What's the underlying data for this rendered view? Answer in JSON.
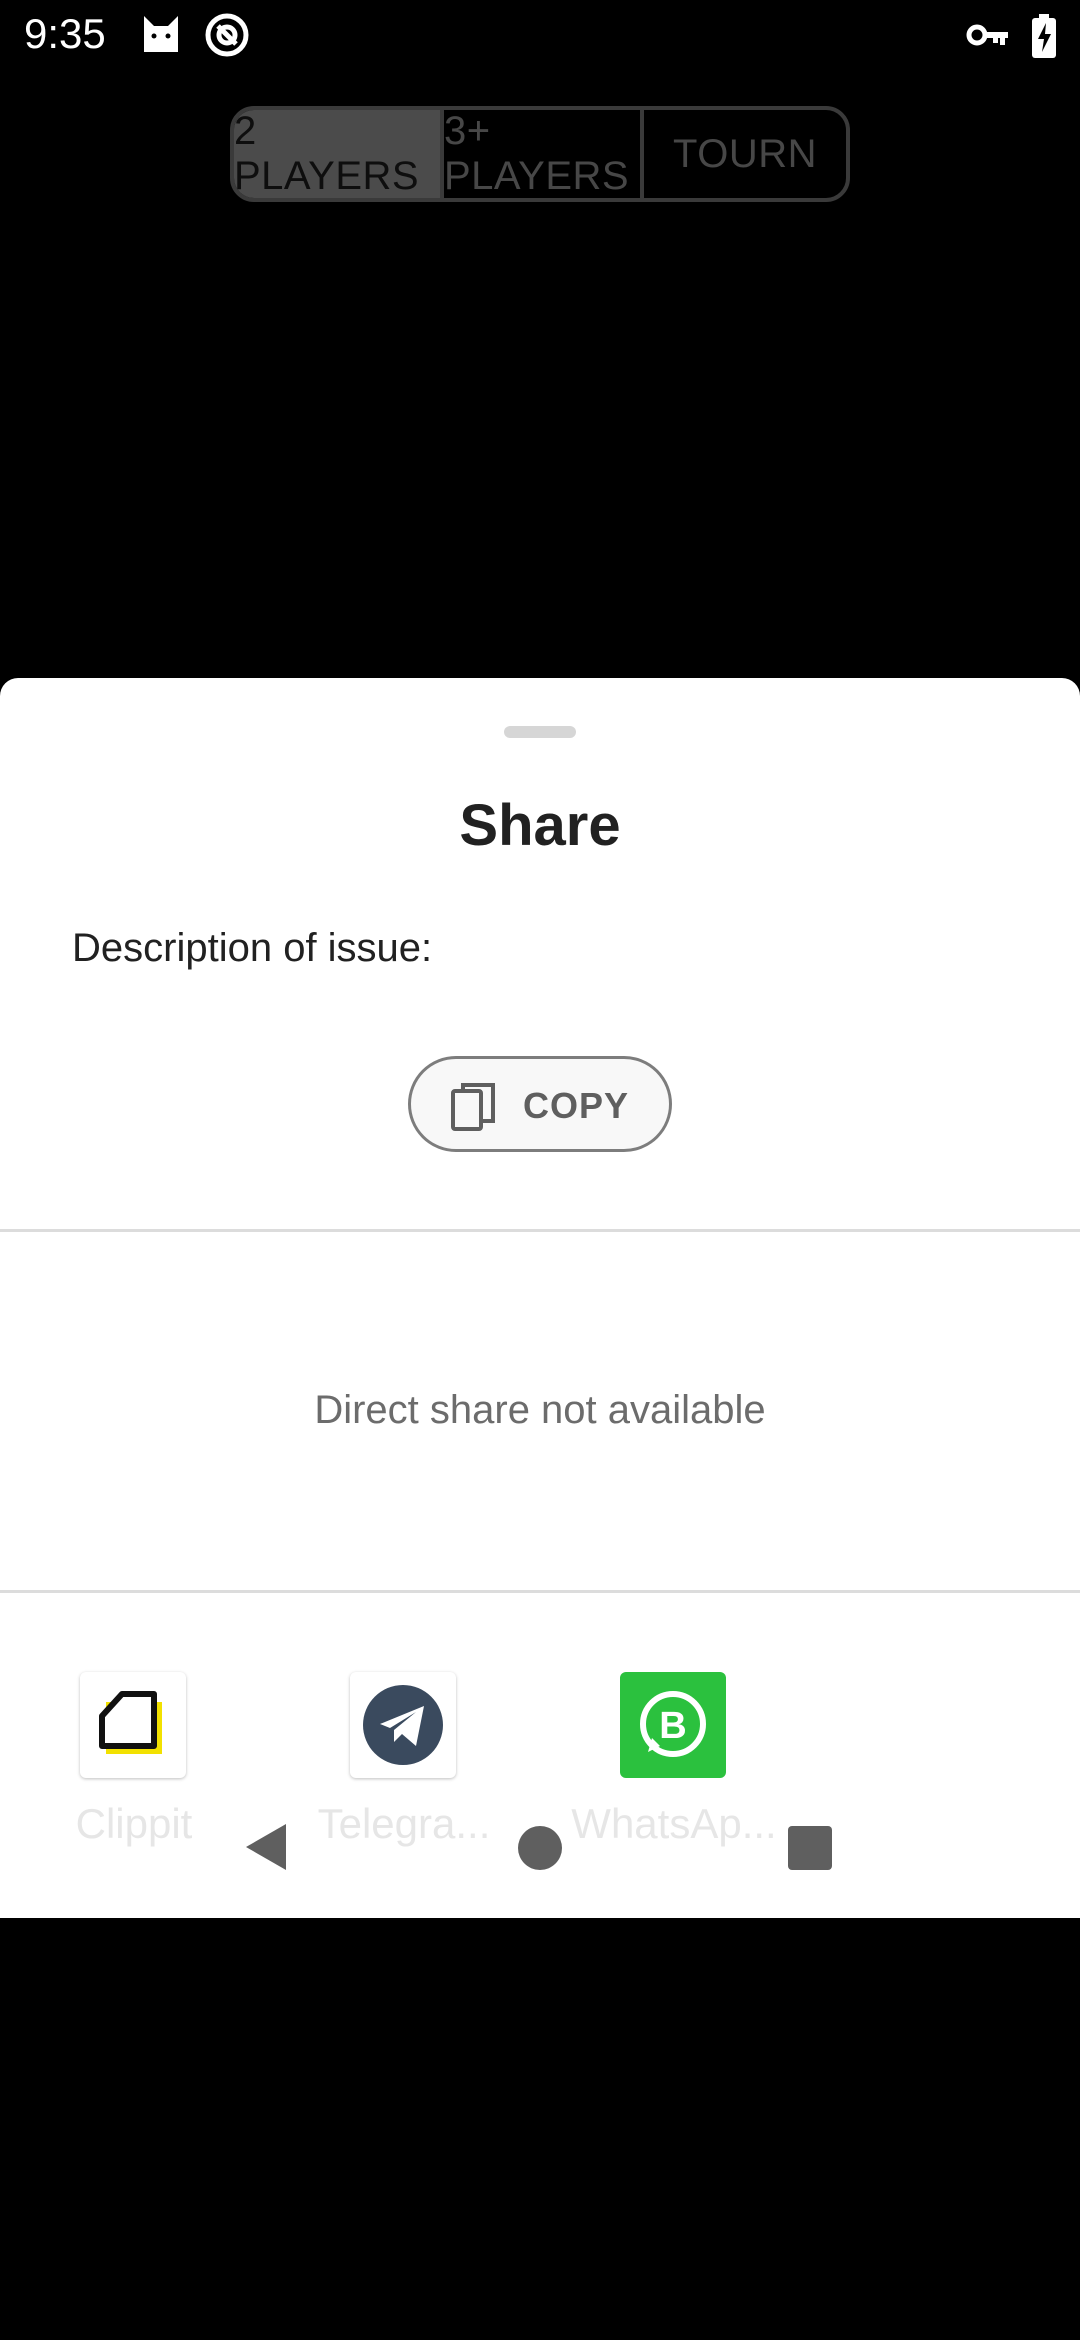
{
  "status_bar": {
    "time": "9:35",
    "icons": [
      "cat-icon",
      "at-sign-icon",
      "key-icon",
      "battery-charging-icon"
    ]
  },
  "mode_tabs": [
    {
      "label": "2 PLAYERS",
      "selected": true
    },
    {
      "label": "3+ PLAYERS",
      "selected": false
    },
    {
      "label": "TOURN",
      "selected": false
    }
  ],
  "share_sheet": {
    "title": "Share",
    "description": "Description of issue:",
    "copy_label": "COPY",
    "direct_share_text": "Direct share not available",
    "apps": [
      {
        "label": "Clippit",
        "icon": "clippit-icon"
      },
      {
        "label": "Telegra...",
        "icon": "telegram-icon"
      },
      {
        "label": "WhatsAp...",
        "icon": "whatsapp-business-icon"
      }
    ]
  },
  "nav_bar": {
    "icons": [
      "back-icon",
      "home-icon",
      "recents-icon"
    ]
  },
  "colors": {
    "background": "#000000",
    "sheet": "#ffffff",
    "whatsapp_green": "#2bc13e",
    "telegram_dark": "#3a4a5e",
    "clippit_yellow": "#f2e100"
  }
}
